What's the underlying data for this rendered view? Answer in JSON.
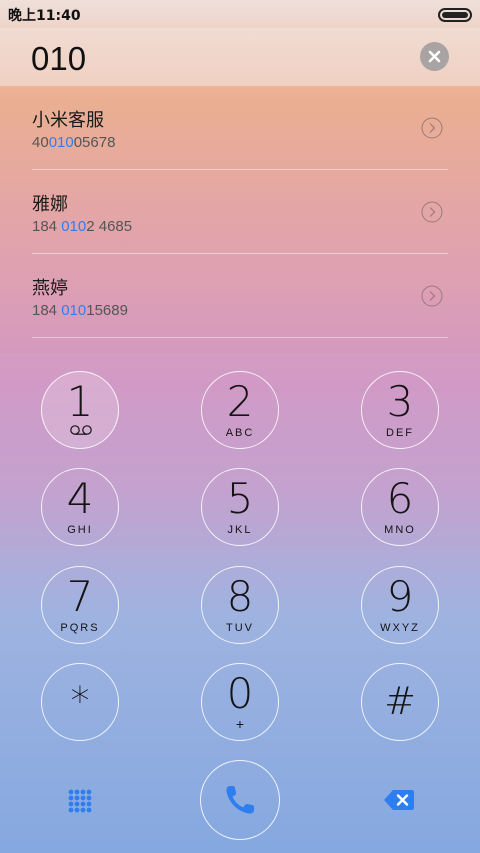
{
  "status": {
    "time": "晚上11:40"
  },
  "dialer": {
    "number": "010"
  },
  "results": [
    {
      "name": "小米客服",
      "number_pre": "40",
      "number_match": "010",
      "number_post": "05678"
    },
    {
      "name": "雅娜",
      "number_pre": "184 ",
      "number_match": "010",
      "number_post": "2 4685"
    },
    {
      "name": "燕婷",
      "number_pre": "184 ",
      "number_match": "010",
      "number_post": "15689"
    }
  ],
  "keys": [
    {
      "digit": "1",
      "letters": ""
    },
    {
      "digit": "2",
      "letters": "ABC"
    },
    {
      "digit": "3",
      "letters": "DEF"
    },
    {
      "digit": "4",
      "letters": "GHI"
    },
    {
      "digit": "5",
      "letters": "JKL"
    },
    {
      "digit": "6",
      "letters": "MNO"
    },
    {
      "digit": "7",
      "letters": "PQRS"
    },
    {
      "digit": "8",
      "letters": "TUV"
    },
    {
      "digit": "9",
      "letters": "WXYZ"
    },
    {
      "digit": "*",
      "letters": ""
    },
    {
      "digit": "0",
      "letters": "+"
    },
    {
      "digit": "#",
      "letters": ""
    }
  ],
  "icons": {
    "clear": "clear-circle-icon",
    "arrow": "chevron-right-circle-icon",
    "voicemail": "voicemail-icon",
    "keypad": "keypad-grid-icon",
    "call": "phone-icon",
    "delete": "backspace-icon"
  },
  "colors": {
    "highlight": "#2f7ef0",
    "accent": "#2f7ef0"
  }
}
